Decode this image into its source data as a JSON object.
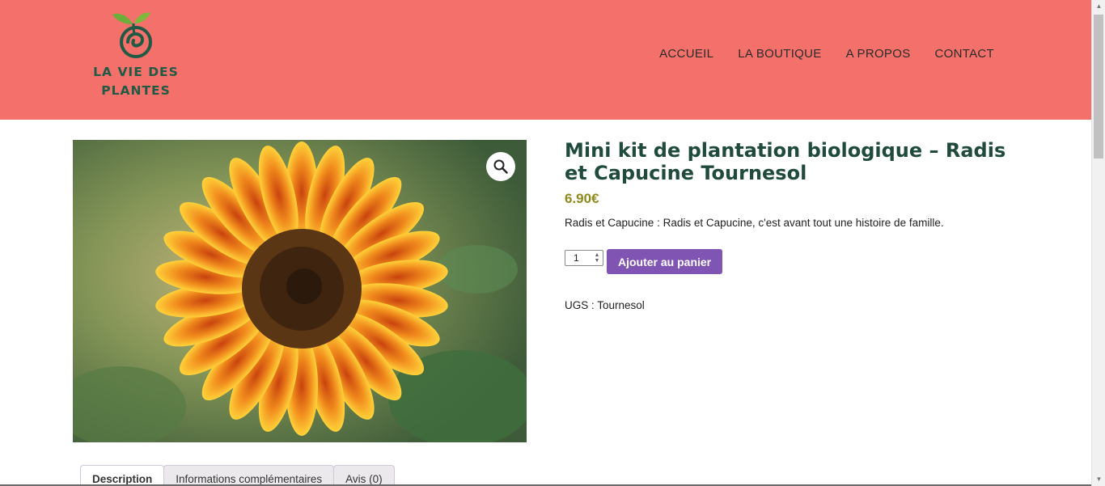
{
  "brand": {
    "name_line1": "LA VIE DES",
    "name_line2": "PLANTES",
    "logo_icon": "sprout-spiral-icon",
    "color": "#1f5a45"
  },
  "nav": {
    "items": [
      "ACCUEIL",
      "LA BOUTIQUE",
      "A PROPOS",
      "CONTACT"
    ]
  },
  "header": {
    "background": "#f4706a"
  },
  "product": {
    "image_alt": "sunflower-image",
    "zoom_icon": "magnifier-icon",
    "title": "Mini kit de plantation biologique – Radis et Capucine Tournesol",
    "price": "6.90€",
    "short_description": "Radis et Capucine : Radis et Capucine, c'est avant tout une histoire de famille.",
    "quantity": "1",
    "add_to_cart_label": "Ajouter au panier",
    "sku_text": "UGS : Tournesol"
  },
  "tabs": [
    "Description",
    "Informations complémentaires",
    "Avis (0)"
  ],
  "colors": {
    "title": "#1f4a3c",
    "price": "#8f8a1a",
    "button": "#7f54b3"
  }
}
